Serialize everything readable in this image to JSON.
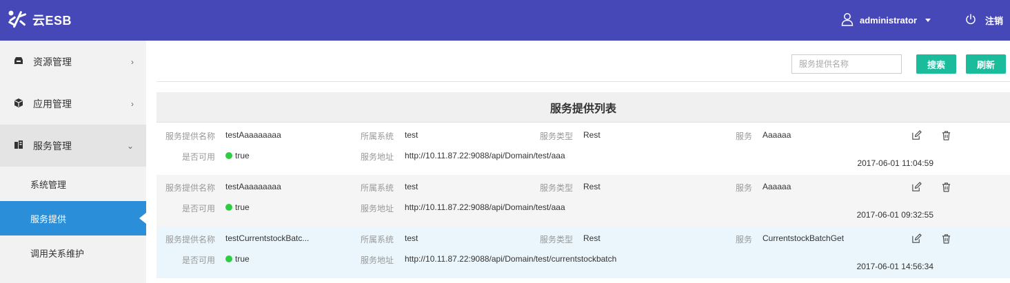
{
  "app": {
    "logo_text": "云ESB"
  },
  "header": {
    "username": "administrator",
    "logout_label": "注销"
  },
  "sidebar": {
    "menus": [
      {
        "label": "资源管理"
      },
      {
        "label": "应用管理"
      },
      {
        "label": "服务管理"
      }
    ],
    "submenus": [
      {
        "label": "系统管理"
      },
      {
        "label": "服务提供"
      },
      {
        "label": "调用关系维护"
      }
    ]
  },
  "toolbar": {
    "search_placeholder": "服务提供名称",
    "search_value": "",
    "search_label": "搜索",
    "refresh_label": "刷新"
  },
  "list": {
    "title": "服务提供列表",
    "labels": {
      "name": "服务提供名称",
      "system": "所属系统",
      "type": "服务类型",
      "service": "服务",
      "available": "是否可用",
      "address": "服务地址"
    },
    "rows": [
      {
        "name": "testAaaaaaaaa",
        "system": "test",
        "type": "Rest",
        "service": "Aaaaaa",
        "available": "true",
        "address": "http://10.11.87.22:9088/api/Domain/test/aaa",
        "timestamp": "2017-06-01 11:04:59"
      },
      {
        "name": "testAaaaaaaaa",
        "system": "test",
        "type": "Rest",
        "service": "Aaaaaa",
        "available": "true",
        "address": "http://10.11.87.22:9088/api/Domain/test/aaa",
        "timestamp": "2017-06-01 09:32:55"
      },
      {
        "name": "testCurrentstockBatc...",
        "system": "test",
        "type": "Rest",
        "service": "CurrentstockBatchGet",
        "available": "true",
        "address": "http://10.11.87.22:9088/api/Domain/test/currentstockbatch",
        "timestamp": "2017-06-01 14:56:34"
      }
    ]
  },
  "colors": {
    "header_bg": "#4648b8",
    "active_menu": "#2a8fd8",
    "button": "#1abc9c",
    "status_dot": "#2ecc40"
  }
}
